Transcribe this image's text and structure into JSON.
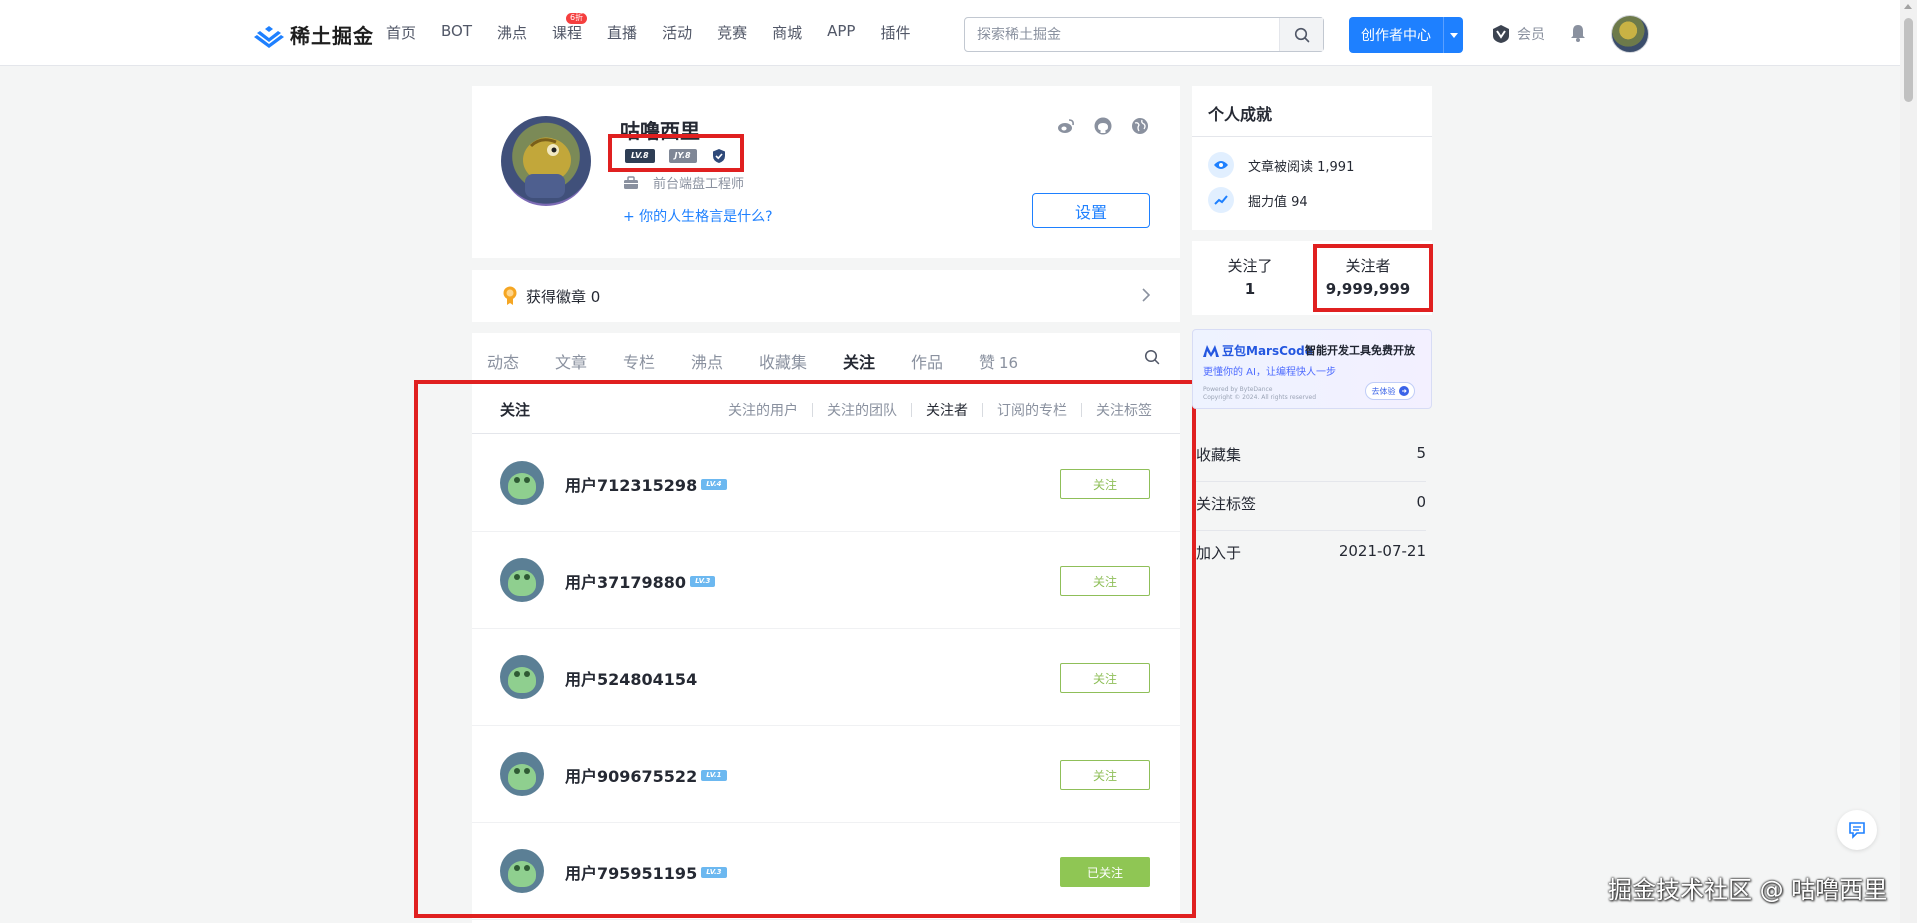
{
  "header": {
    "logo_text": "稀土掘金",
    "nav": [
      {
        "label": "首页",
        "badge": ""
      },
      {
        "label": "BOT",
        "badge": ""
      },
      {
        "label": "沸点",
        "badge": ""
      },
      {
        "label": "课程",
        "badge": "6折"
      },
      {
        "label": "直播",
        "badge": ""
      },
      {
        "label": "活动",
        "badge": ""
      },
      {
        "label": "竞赛",
        "badge": ""
      },
      {
        "label": "商城",
        "badge": ""
      },
      {
        "label": "APP",
        "badge": ""
      },
      {
        "label": "插件",
        "badge": ""
      }
    ],
    "search_placeholder": "探索稀土掘金",
    "creator_label": "创作者中心",
    "vip_label": "会员",
    "accent_color": "#1e80ff"
  },
  "profile": {
    "name": "咕噜西里",
    "badges": [
      "LV.8",
      "JY.8"
    ],
    "job": "前台端盘工程师",
    "motto_prompt": "+ 你的人生格言是什么?",
    "settings_label": "设置",
    "social_icons": [
      "weibo-icon",
      "github-icon",
      "website-icon"
    ]
  },
  "badge_row": {
    "label": "获得徽章 0"
  },
  "tabs": [
    {
      "label": "动态",
      "count": "",
      "active": false
    },
    {
      "label": "文章",
      "count": "",
      "active": false
    },
    {
      "label": "专栏",
      "count": "",
      "active": false
    },
    {
      "label": "沸点",
      "count": "",
      "active": false
    },
    {
      "label": "收藏集",
      "count": "",
      "active": false
    },
    {
      "label": "关注",
      "count": "",
      "active": true
    },
    {
      "label": "作品",
      "count": "",
      "active": false
    },
    {
      "label": "赞",
      "count": "16",
      "active": false
    }
  ],
  "follow": {
    "title": "关注",
    "sub_nav": [
      "关注的用户",
      "关注的团队",
      "关注者",
      "订阅的专栏",
      "关注标签"
    ],
    "active_sub": "关注者",
    "users": [
      {
        "name": "用户712315298",
        "level": "LV.4",
        "button": "关注",
        "followed": false
      },
      {
        "name": "用户37179880",
        "level": "LV.3",
        "button": "关注",
        "followed": false
      },
      {
        "name": "用户524804154",
        "level": "",
        "button": "关注",
        "followed": false
      },
      {
        "name": "用户909675522",
        "level": "LV.1",
        "button": "关注",
        "followed": false
      },
      {
        "name": "用户795951195",
        "level": "LV.3",
        "button": "已关注",
        "followed": true
      }
    ]
  },
  "sidebar": {
    "achievement_title": "个人成就",
    "achievements": [
      {
        "icon": "eye-icon",
        "text": "文章被阅读 1,991"
      },
      {
        "icon": "trend-icon",
        "text": "掘力值 94"
      }
    ],
    "stats": [
      {
        "label": "关注了",
        "value": "1"
      },
      {
        "label": "关注者",
        "value": "9,999,999"
      }
    ],
    "ad": {
      "brand": "豆包MarsCode",
      "tagline": "智能开发工具免费开放",
      "subline": "更懂你的 AI，让编程快人一步",
      "footnote": "Powered by ByteDance\nCopyright © 2024. All rights reserved",
      "button": "去体验"
    },
    "info": [
      {
        "label": "收藏集",
        "value": "5"
      },
      {
        "label": "关注标签",
        "value": "0"
      },
      {
        "label": "加入于",
        "value": "2021-07-21"
      }
    ]
  },
  "watermark": "掘金技术社区 @ 咕噜西里",
  "highlight_color": "#e02020"
}
